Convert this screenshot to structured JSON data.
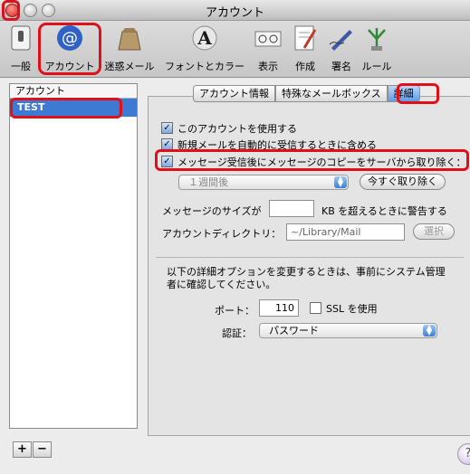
{
  "window": {
    "title": "アカウント"
  },
  "toolbar": {
    "items": [
      {
        "label": "一般",
        "icon": "general-switch-icon"
      },
      {
        "label": "アカウント",
        "icon": "at-sign-icon"
      },
      {
        "label": "迷惑メール",
        "icon": "junk-mail-bag-icon"
      },
      {
        "label": "フォントとカラー",
        "icon": "font-a-icon"
      },
      {
        "label": "表示",
        "icon": "viewing-icon"
      },
      {
        "label": "作成",
        "icon": "composing-icon"
      },
      {
        "label": "署名",
        "icon": "signature-pen-icon"
      },
      {
        "label": "ルール",
        "icon": "rules-icon"
      }
    ]
  },
  "sidebar": {
    "header": "アカウント",
    "items": [
      "TEST"
    ],
    "add": "+",
    "remove": "−"
  },
  "tabs": [
    "アカウント情報",
    "特殊なメールボックス",
    "詳細"
  ],
  "advanced": {
    "opt_use": "このアカウントを使用する",
    "opt_auto": "新規メールを自動的に受信するときに含める",
    "opt_remove": "メッセージ受信後にメッセージのコピーをサーバから取り除く：",
    "period": "１週間後",
    "remove_now": "今すぐ取り除く",
    "size_label": "メッセージのサイズが",
    "size_suffix": "KB を超えるときに警告する",
    "dir_label": "アカウントディレクトリ：",
    "dir_value": "~/Library/Mail",
    "choose": "選択",
    "note": "以下の詳細オプションを変更するときは、事前にシステム管理者に確認してください。",
    "port_label": "ポート：",
    "port_value": "110",
    "ssl_label": "SSL を使用",
    "auth_label": "認証：",
    "auth_value": "パスワード"
  },
  "colors": {
    "highlight": "#e0101a",
    "selection": "#3d7ad4"
  }
}
